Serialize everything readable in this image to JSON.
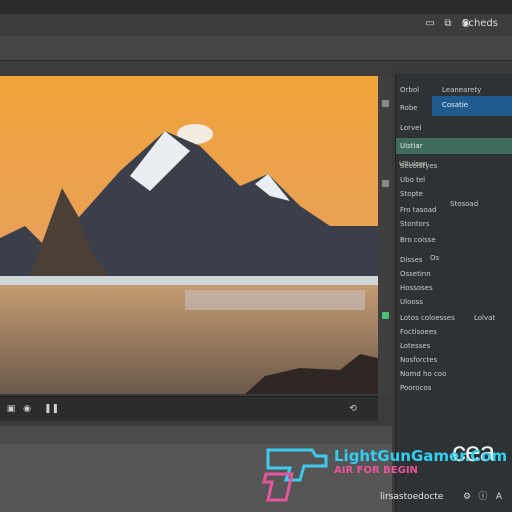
{
  "toolbar": {
    "label": "Scheds",
    "icons": [
      "import-icon",
      "copy-icon",
      "eye-icon",
      "settings-icon"
    ]
  },
  "viewer": {
    "image": "mountain-lake-photo",
    "sky_color": "#e8982f"
  },
  "transport": {
    "icons": [
      "frame-icon",
      "record-icon",
      "pause-icon",
      "loop-icon"
    ]
  },
  "panel": {
    "header_left": "Orbol",
    "header_right": "Leanearety",
    "rows": [
      {
        "label": "Robe"
      },
      {
        "label": "Lorvel"
      },
      {
        "label": "Ultuisen"
      },
      {
        "label": "Secoistyes"
      },
      {
        "label": "Ubo tel"
      },
      {
        "label": "Stopte"
      },
      {
        "label": "Fro tasoad",
        "value": "Stosoad"
      },
      {
        "label": "Stontors"
      },
      {
        "label": "Bro coisse"
      },
      {
        "label": "Disses",
        "value": "Os"
      },
      {
        "label": "Ossetinn"
      },
      {
        "label": "Hossoses"
      },
      {
        "label": "Ulooss"
      },
      {
        "label": "Lotos coloesses",
        "value": "Lolvat"
      },
      {
        "label": "Foctisoees"
      },
      {
        "label": "Lotesses"
      },
      {
        "label": "Nosforctes"
      },
      {
        "label": "Nomd ho coo"
      },
      {
        "label": "Poorocos"
      }
    ],
    "selected_label": "Cosatie",
    "highlight_label": "Uistiar"
  },
  "brand": {
    "text": "cea"
  },
  "watermark": {
    "site": "LightGunGamer.Com",
    "tagline": "AIR FOR BEGIN"
  },
  "status": {
    "text": "lirsastoedocte"
  }
}
